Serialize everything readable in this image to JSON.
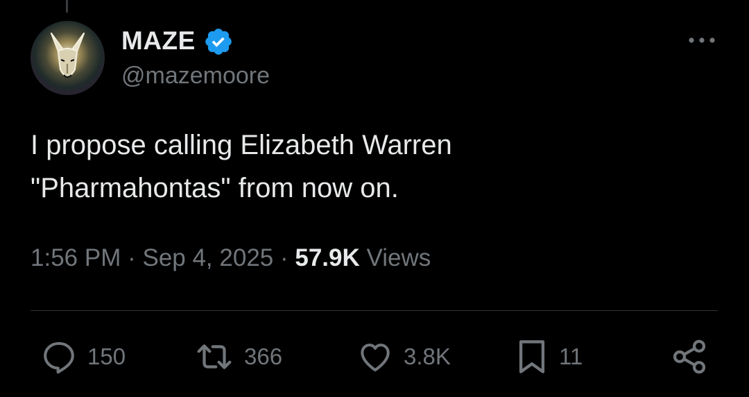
{
  "author": {
    "display_name": "MAZE",
    "handle": "@mazemoore",
    "verified": true,
    "avatar_icon": "doberman-avatar",
    "verified_icon": "verified-badge-icon",
    "verified_color": "#1d9bf0"
  },
  "tweet": {
    "text_lines": [
      "I propose calling Elizabeth Warren",
      "\"Pharmahontas\" from now on."
    ]
  },
  "meta": {
    "time": "1:56 PM",
    "separator": " · ",
    "date": "Sep 4, 2025",
    "views_count": "57.9K",
    "views_label": " Views"
  },
  "actions": {
    "replies": "150",
    "reposts": "366",
    "likes": "3.8K",
    "bookmarks": "11"
  },
  "colors": {
    "background": "#000000",
    "text_primary": "#e7e9ea",
    "text_secondary": "#71767b",
    "divider": "#2f3336"
  }
}
